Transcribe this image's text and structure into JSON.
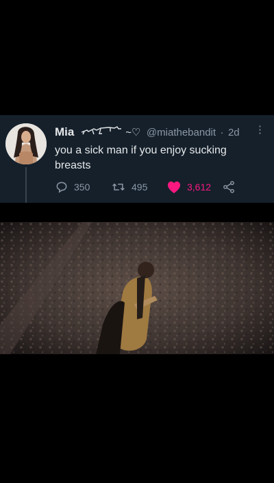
{
  "tweet": {
    "author_name": "Mia",
    "name_emoji_suffix": "~♡",
    "handle": "@miathebandit",
    "separator": "·",
    "time": "2d",
    "text": "you a sick man if you enjoy sucking breasts",
    "more_label": "⋮",
    "replies": "350",
    "retweets": "495",
    "likes": "3,612",
    "liked": true
  },
  "colors": {
    "tweet_bg": "#15202b",
    "text": "#e7e9ea",
    "secondary": "#8b98a5",
    "like": "#f91880"
  },
  "icons": [
    "reply-icon",
    "retweet-icon",
    "heart-icon",
    "share-icon",
    "gun-emoji-icon"
  ]
}
